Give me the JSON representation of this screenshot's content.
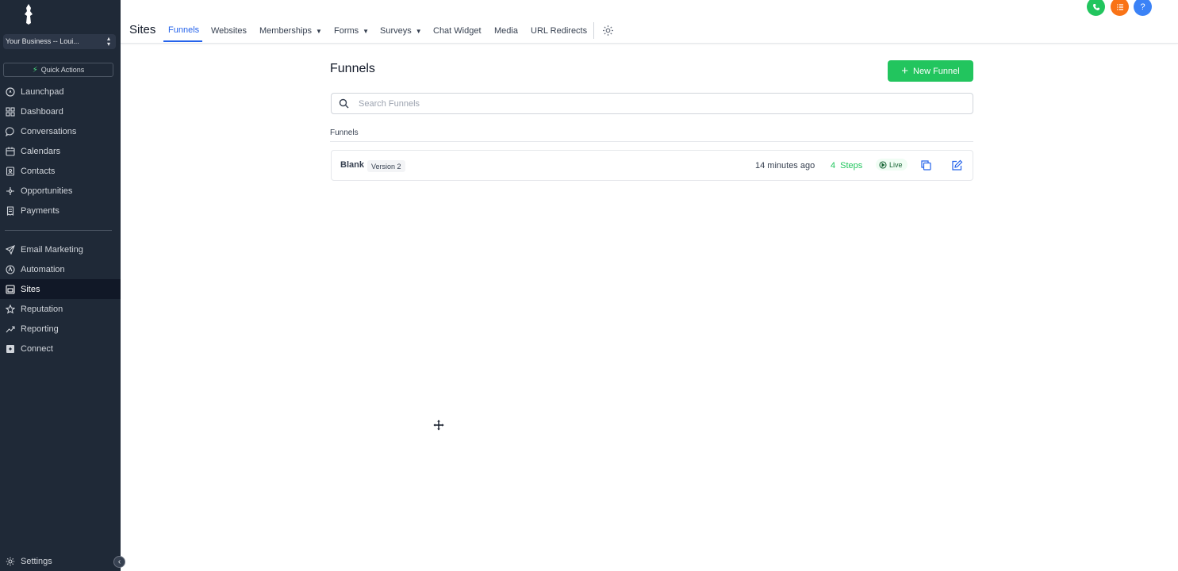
{
  "sidebar": {
    "business": "Your Business -- Loui...",
    "quick_actions": "Quick Actions",
    "items": [
      {
        "label": "Launchpad",
        "icon": "rocket-icon"
      },
      {
        "label": "Dashboard",
        "icon": "dashboard-icon"
      },
      {
        "label": "Conversations",
        "icon": "chat-icon"
      },
      {
        "label": "Calendars",
        "icon": "calendar-icon"
      },
      {
        "label": "Contacts",
        "icon": "contacts-icon"
      },
      {
        "label": "Opportunities",
        "icon": "filter-icon"
      },
      {
        "label": "Payments",
        "icon": "receipt-icon"
      },
      {
        "label": "Email Marketing",
        "icon": "send-icon"
      },
      {
        "label": "Automation",
        "icon": "automation-icon"
      },
      {
        "label": "Sites",
        "icon": "sites-icon"
      },
      {
        "label": "Reputation",
        "icon": "star-icon"
      },
      {
        "label": "Reporting",
        "icon": "trend-icon"
      },
      {
        "label": "Connect",
        "icon": "connect-icon"
      }
    ],
    "settings": "Settings",
    "active": "Sites"
  },
  "topbar": {
    "section": "Sites",
    "tabs": [
      {
        "label": "Funnels",
        "active": true
      },
      {
        "label": "Websites"
      },
      {
        "label": "Memberships",
        "dropdown": true
      },
      {
        "label": "Forms",
        "dropdown": true
      },
      {
        "label": "Surveys",
        "dropdown": true
      },
      {
        "label": "Chat Widget"
      },
      {
        "label": "Media"
      },
      {
        "label": "URL Redirects"
      }
    ],
    "buttons": [
      {
        "icon": "phone-icon",
        "color": "#22c55e"
      },
      {
        "icon": "list-icon",
        "color": "#f97316"
      },
      {
        "icon": "help-icon",
        "color": "#3b82f6",
        "glyph": "?"
      }
    ]
  },
  "main": {
    "title": "Funnels",
    "new_button": "New Funnel",
    "search_placeholder": "Search Funnels",
    "section_label": "Funnels",
    "funnels": [
      {
        "name": "Blank",
        "version": "Version 2",
        "updated": "14 minutes ago",
        "steps_count": "4",
        "steps_label": "Steps",
        "status": "Live"
      }
    ]
  },
  "colors": {
    "sidebar_bg": "#1f2937",
    "accent": "#2563eb",
    "success": "#22c55e"
  }
}
